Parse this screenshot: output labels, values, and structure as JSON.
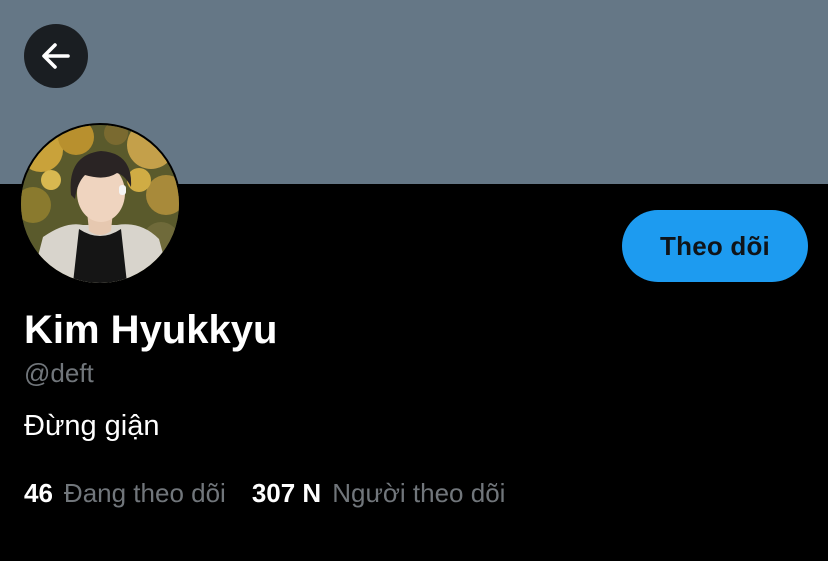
{
  "profile": {
    "display_name": "Kim Hyukkyu",
    "handle": "@deft",
    "bio": "Đừng giận",
    "follow_label": "Theo dõi"
  },
  "stats": {
    "following_count": "46",
    "following_label": "Đang theo dõi",
    "followers_count": "307 N",
    "followers_label": "Người theo dõi"
  },
  "colors": {
    "banner": "#657786",
    "background": "#000000",
    "accent": "#1d9bf0",
    "secondary_text": "#71767b"
  },
  "icons": {
    "back": "arrow-left-icon"
  }
}
